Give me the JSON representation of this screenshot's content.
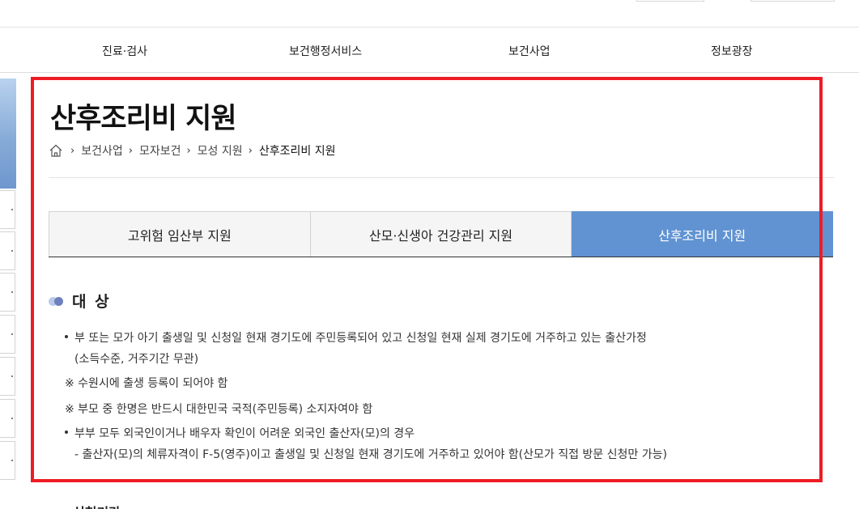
{
  "gnb": {
    "items": [
      "진료·검사",
      "보건행정서비스",
      "보건사업",
      "정보광장"
    ]
  },
  "page": {
    "title": "산후조리비 지원"
  },
  "breadcrumb": {
    "items": [
      "보건사업",
      "모자보건",
      "모성 지원"
    ],
    "current": "산후조리비 지원",
    "separator": "›"
  },
  "tabs": [
    {
      "label": "고위험 임산부 지원",
      "active": false
    },
    {
      "label": "산모·신생아 건강관리 지원",
      "active": false
    },
    {
      "label": "산후조리비 지원",
      "active": true
    }
  ],
  "section": {
    "title": "대 상",
    "lines": [
      "부 또는 모가 아기 출생일 및 신청일 현재 경기도에 주민등록되어 있고 신청일 현재 실제 경기도에 거주하고 있는 출산가정",
      "(소득수준, 거주기간 무관)",
      "※ 수원시에 출생 등록이 되어야 함",
      "※ 부모 중 한명은 반드시 대한민국 국적(주민등록) 소지자여야 함",
      "부부 모두 외국인이거나 배우자 확인이 어려운 외국인 출산자(모)의 경우",
      "- 출산자(모)의 체류자격이 F-5(영주)이고 출생일 및 신청일 현재 경기도에 거주하고 있어야 함(산모가 직접 방문 신청만 가능)"
    ]
  },
  "next_section": {
    "title": "신청기간"
  },
  "icons": {
    "home": "home-icon",
    "section": "section-dots-icon"
  },
  "colors": {
    "active_tab": "#6193d2",
    "highlight_frame": "#ee1c24",
    "section_dot_light": "#b8cbeb",
    "section_dot_dark": "#6e7fbd"
  }
}
